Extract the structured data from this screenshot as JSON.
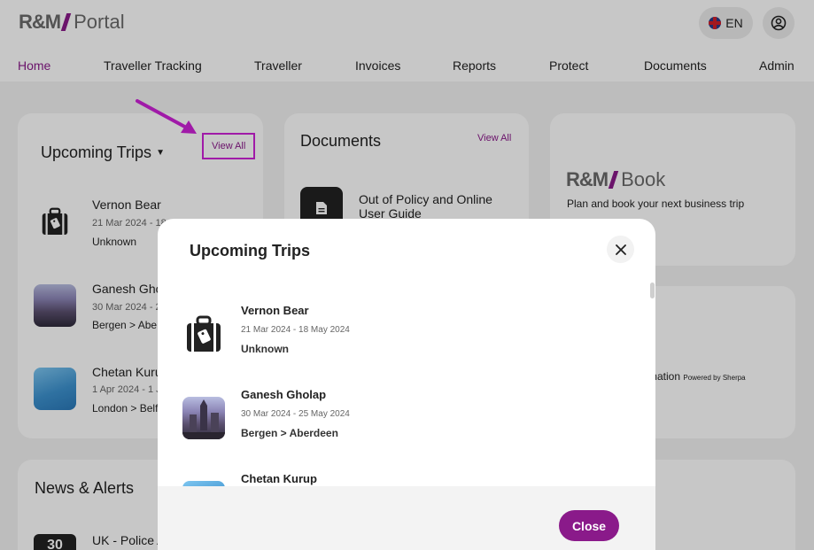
{
  "app": {
    "logo_left": "R&M",
    "logo_right": "Portal",
    "language": "EN"
  },
  "nav": [
    "Home",
    "Traveller Tracking",
    "Traveller",
    "Invoices",
    "Reports",
    "Protect",
    "Documents",
    "Admin"
  ],
  "upcoming_card": {
    "title": "Upcoming Trips",
    "view_all": "View All",
    "trips": [
      {
        "name": "Vernon Bear",
        "date": "21 Mar 2024 - 18",
        "route": "Unknown"
      },
      {
        "name": "Ganesh Gho",
        "date": "30 Mar 2024 - 2",
        "route": "Bergen > Abe"
      },
      {
        "name": "Chetan Kuru",
        "date": "1 Apr 2024 - 1 J",
        "route": "London > Belf"
      }
    ]
  },
  "documents_card": {
    "title": "Documents",
    "view_all": "View All",
    "item": "Out of Policy and Online User Guide"
  },
  "book_card": {
    "logo_left": "R&M",
    "logo_right": "Book",
    "tagline": "Plan and book your next business trip"
  },
  "sherpa_card": {
    "text": "rmation",
    "powered": "Powered by Sherpa"
  },
  "news_card": {
    "title": "News & Alerts",
    "date_badge": "30",
    "item": "UK - Police A"
  },
  "modal": {
    "title": "Upcoming Trips",
    "trips": [
      {
        "name": "Vernon Bear",
        "date": "21 Mar 2024 - 18 May 2024",
        "route": "Unknown",
        "icon": "suitcase-icon"
      },
      {
        "name": "Ganesh Gholap",
        "date": "30 Mar 2024 - 25 May 2024",
        "route": "Bergen > Aberdeen",
        "icon": "city-thumbnail"
      },
      {
        "name": "Chetan Kurup",
        "date": "",
        "route": "",
        "icon": "plane-thumbnail"
      }
    ],
    "close_label": "Close"
  },
  "colors": {
    "accent": "#8a1a8a",
    "annotation": "#a01aa8"
  }
}
